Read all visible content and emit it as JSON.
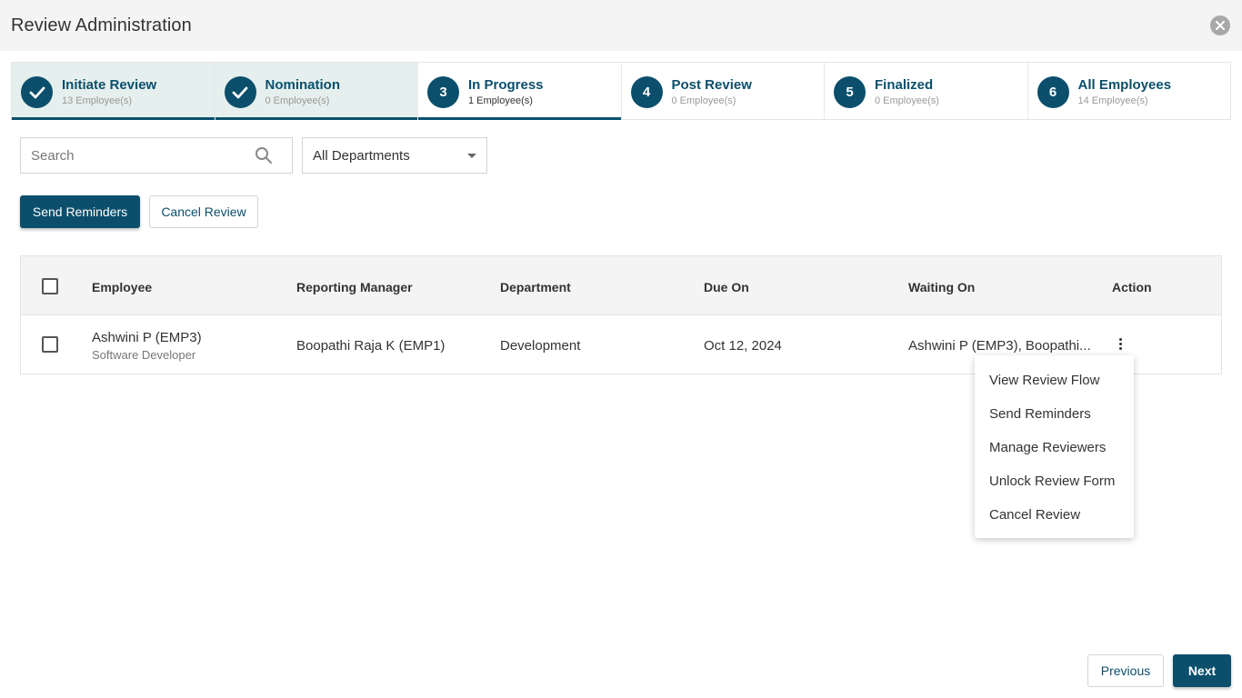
{
  "header": {
    "title": "Review Administration",
    "close_icon": "close-icon"
  },
  "steps": [
    {
      "number": "",
      "label": "Initiate Review",
      "sub": "13 Employee(s)",
      "state": "done",
      "icon": "check-icon"
    },
    {
      "number": "",
      "label": "Nomination",
      "sub": "0 Employee(s)",
      "state": "done",
      "icon": "check-icon"
    },
    {
      "number": "3",
      "label": "In Progress",
      "sub": "1 Employee(s)",
      "state": "active"
    },
    {
      "number": "4",
      "label": "Post Review",
      "sub": "0 Employee(s)",
      "state": "pending"
    },
    {
      "number": "5",
      "label": "Finalized",
      "sub": "0 Employee(s)",
      "state": "pending"
    },
    {
      "number": "6",
      "label": "All Employees",
      "sub": "14 Employee(s)",
      "state": "pending"
    }
  ],
  "filters": {
    "search_placeholder": "Search",
    "search_value": "",
    "search_icon": "search-icon",
    "department_selected": "All Departments",
    "department_icon": "chevron-down-icon"
  },
  "actions": {
    "send_reminders": "Send Reminders",
    "cancel_review": "Cancel Review"
  },
  "table": {
    "columns": [
      "Employee",
      "Reporting Manager",
      "Department",
      "Due On",
      "Waiting On",
      "Action"
    ],
    "rows": [
      {
        "employee_name": "Ashwini P (EMP3)",
        "employee_title": "Software Developer",
        "reporting_manager": "Boopathi Raja K (EMP1)",
        "department": "Development",
        "due_on": "Oct 12, 2024",
        "waiting_on": "Ashwini P (EMP3), Boopathi...",
        "action_icon": "more-vertical-icon"
      }
    ]
  },
  "action_menu": {
    "items": [
      "View Review Flow",
      "Send Reminders",
      "Manage Reviewers",
      "Unlock Review Form",
      "Cancel Review"
    ]
  },
  "footer": {
    "previous": "Previous",
    "next": "Next"
  },
  "colors": {
    "brand": "#0b4f6c",
    "done_step_bg": "#e5efed",
    "header_bg": "#f4f4f4"
  }
}
